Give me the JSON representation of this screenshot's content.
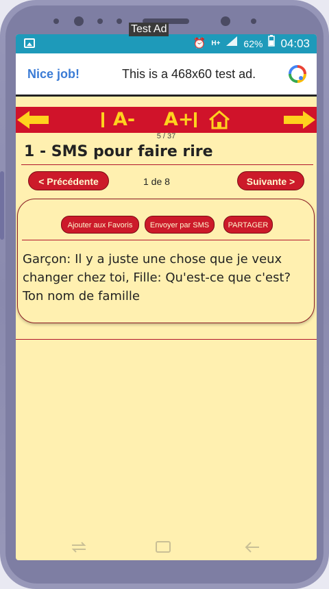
{
  "statusbar": {
    "battery": "62%",
    "time": "04:03",
    "network": "H+"
  },
  "ad": {
    "label": "Test Ad",
    "nice": "Nice job!",
    "text": "This is a 468x60 test ad."
  },
  "toolbar": {
    "font_decrease": "A-",
    "font_increase": "A+"
  },
  "counter": "5 / 37",
  "title": "1 - SMS pour faire rire",
  "nav": {
    "prev": "< Précédente",
    "page": "1 de 8",
    "next": "Suivante >"
  },
  "actions": {
    "favorites": "Ajouter aux Favoris",
    "sms": "Envoyer par SMS",
    "share": "PARTAGER"
  },
  "joke_text": "Garçon: Il y a juste une chose que je veux changer chez toi, Fille: Qu'est-ce que c'est? Ton nom de famille",
  "colors": {
    "accent": "#d0132a",
    "highlight": "#ffd21e",
    "background": "#fff0b0",
    "statusbar": "#1e9aba"
  }
}
